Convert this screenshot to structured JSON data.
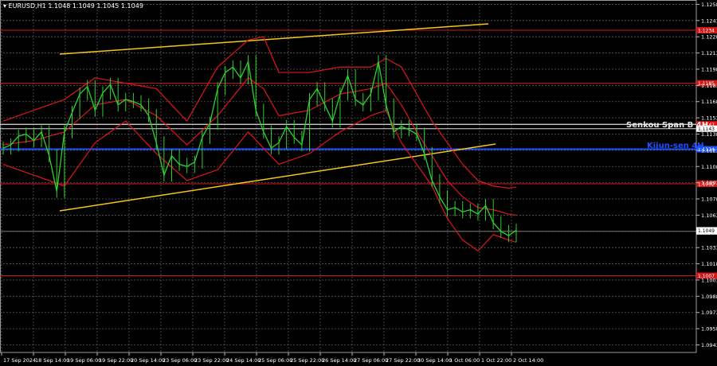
{
  "header": "▾ EURUSD,H1  1.1048 1.1049 1.1045 1.1049",
  "colors": {
    "background": "#000000",
    "grid": "#5a5a5a",
    "candle": "#2ed12e",
    "bollinger": "#e0141e",
    "channel": "#f5c518",
    "resistance": "#d01818",
    "senkou": "#c8c8c8",
    "kijun": "#1e50ff",
    "axis_text": "#ffffff",
    "current_price_box": "#ffffff"
  },
  "price_axis_ticks": [
    "1.1258",
    "1.1243",
    "1.1228",
    "1.1213",
    "1.1198",
    "1.1183",
    "1.1168",
    "1.1153",
    "1.1138",
    "1.1123",
    "1.1108",
    "1.1093",
    "1.1078",
    "1.1063",
    "1.1048",
    "1.1033",
    "1.1018",
    "1.1003",
    "1.0988",
    "1.0973",
    "1.0958",
    "1.0943"
  ],
  "time_axis_labels": [
    "17 Sep 2024",
    "18 Sep 14:00",
    "19 Sep 06:00",
    "19 Sep 22:00",
    "20 Sep 14:00",
    "23 Sep 06:00",
    "23 Sep 22:00",
    "24 Sep 14:00",
    "25 Sep 06:00",
    "25 Sep 22:00",
    "26 Sep 14:00",
    "27 Sep 06:00",
    "27 Sep 22:00",
    "30 Sep 14:00",
    "1 Oct 06:00",
    "1 Oct 22:00",
    "2 Oct 14:00"
  ],
  "indicator_labels": {
    "senkou": "Senkou Span B 4H",
    "kijun": "Kijun-sen 4H"
  },
  "chart_data": {
    "type": "line",
    "title": "",
    "symbol": "EURUSD",
    "timeframe": "H1",
    "ylim": [
      1.0936,
      1.1262
    ],
    "levels": [
      {
        "price": 1.1234,
        "label": "1.1234",
        "kind": "resistance"
      },
      {
        "price": 1.1185,
        "label": "1.1185",
        "kind": "resistance"
      },
      {
        "price": 1.1147,
        "label": "1.1147",
        "kind": "senkou"
      },
      {
        "price": 1.1143,
        "label": "1.1143",
        "kind": "support"
      },
      {
        "price": 1.1124,
        "label": "1.1124",
        "kind": "kijun"
      },
      {
        "price": 1.1092,
        "label": "1.1092",
        "kind": "resistance"
      },
      {
        "price": 1.1048,
        "label": "1.1048",
        "kind": "plain"
      },
      {
        "price": 1.1007,
        "label": "1.1007",
        "kind": "resistance"
      }
    ],
    "current_price": "1.1049",
    "trend_channel": [
      {
        "x": [
          0.0,
          67.0
        ],
        "y": [
          1.118,
          1.1233
        ]
      },
      {
        "x": [
          0.0,
          67.0
        ],
        "y": [
          1.1069,
          1.1131
        ]
      }
    ],
    "price_series": {
      "name": "",
      "x": [
        0,
        1,
        2,
        3,
        4,
        5,
        6,
        7,
        8,
        9,
        10,
        11,
        12,
        13,
        14,
        15,
        16,
        17,
        18,
        19,
        20,
        21,
        22,
        23,
        24,
        25,
        26,
        27,
        28,
        29,
        30,
        31,
        32,
        33,
        34,
        35,
        36,
        37,
        38,
        39,
        40,
        41,
        42,
        43,
        44,
        45,
        46,
        47,
        48,
        49,
        50,
        51,
        52,
        53,
        54,
        55,
        56,
        57,
        58,
        59,
        60,
        61,
        62,
        63,
        64,
        65,
        66,
        67
      ],
      "y": [
        1.1125,
        1.1128,
        1.1136,
        1.1138,
        1.1132,
        1.114,
        1.1118,
        1.1085,
        1.114,
        1.1158,
        1.1175,
        1.1182,
        1.116,
        1.1176,
        1.1184,
        1.1165,
        1.117,
        1.1168,
        1.1165,
        1.1155,
        1.113,
        1.11,
        1.1118,
        1.111,
        1.1108,
        1.1112,
        1.1135,
        1.1148,
        1.118,
        1.1195,
        1.12,
        1.119,
        1.1205,
        1.116,
        1.114,
        1.1125,
        1.113,
        1.1145,
        1.1135,
        1.1128,
        1.117,
        1.118,
        1.1165,
        1.115,
        1.1175,
        1.1192,
        1.117,
        1.1165,
        1.1175,
        1.1205,
        1.1165,
        1.114,
        1.1145,
        1.1142,
        1.1138,
        1.112,
        1.1095,
        1.108,
        1.1068,
        1.107,
        1.1066,
        1.1068,
        1.1064,
        1.1072,
        1.1056,
        1.1048,
        1.1044,
        1.1049
      ]
    },
    "bollinger_upper": {
      "x": [
        0,
        4,
        8,
        12,
        16,
        20,
        24,
        28,
        32,
        34,
        36,
        40,
        44,
        48,
        50,
        52,
        54,
        56,
        58,
        60,
        62,
        64,
        66,
        67
      ],
      "y": [
        1.115,
        1.116,
        1.117,
        1.119,
        1.1185,
        1.118,
        1.115,
        1.12,
        1.1225,
        1.1228,
        1.1195,
        1.1195,
        1.12,
        1.12,
        1.1208,
        1.12,
        1.1175,
        1.115,
        1.113,
        1.111,
        1.1095,
        1.109,
        1.1088,
        1.1089
      ]
    },
    "bollinger_middle": {
      "x": [
        0,
        4,
        8,
        12,
        16,
        20,
        24,
        28,
        32,
        34,
        36,
        40,
        44,
        48,
        50,
        52,
        54,
        56,
        58,
        60,
        62,
        64,
        66,
        67
      ],
      "y": [
        1.1128,
        1.1132,
        1.114,
        1.1165,
        1.117,
        1.1155,
        1.1128,
        1.1155,
        1.119,
        1.118,
        1.1155,
        1.116,
        1.1175,
        1.118,
        1.1185,
        1.1165,
        1.114,
        1.1118,
        1.1095,
        1.108,
        1.107,
        1.1068,
        1.1064,
        1.1063
      ]
    },
    "bollinger_lower": {
      "x": [
        0,
        4,
        8,
        12,
        16,
        20,
        24,
        28,
        32,
        34,
        36,
        40,
        44,
        48,
        50,
        52,
        54,
        56,
        58,
        60,
        62,
        64,
        66,
        67
      ],
      "y": [
        1.111,
        1.11,
        1.109,
        1.113,
        1.115,
        1.112,
        1.1095,
        1.1105,
        1.114,
        1.1125,
        1.111,
        1.112,
        1.114,
        1.1155,
        1.116,
        1.113,
        1.111,
        1.109,
        1.106,
        1.104,
        1.103,
        1.1045,
        1.104,
        1.1038
      ]
    }
  }
}
